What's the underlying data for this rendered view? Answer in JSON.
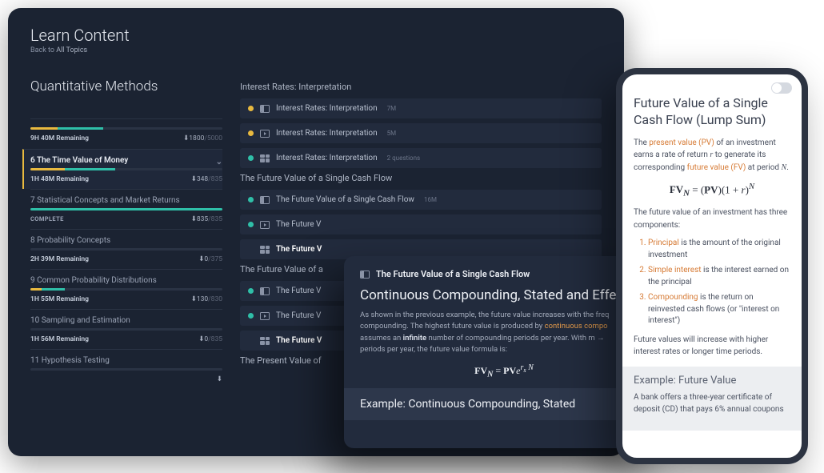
{
  "header": {
    "title": "Learn Content",
    "back_prefix": "Back to ",
    "back_link": "All Topics"
  },
  "sidebar": {
    "section_title": "Quantitative Methods",
    "overview": {
      "remaining": "9H 40M Remaining",
      "points": "1800",
      "max": "/5000",
      "yellow_pct": 14,
      "teal_pct": 24
    },
    "chapters": [
      {
        "title": "6 The Time Value of Money",
        "remaining": "1H 48M Remaining",
        "points": "348",
        "max": "/835",
        "active": true,
        "yellow_pct": 18,
        "teal_pct": 26
      },
      {
        "title": "7 Statistical Concepts and Market Returns",
        "status": "COMPLETE",
        "points": "835",
        "max": "/835",
        "yellow_pct": 0,
        "teal_pct": 100
      },
      {
        "title": "8 Probability Concepts",
        "remaining": "2H 39M Remaining",
        "points": "0",
        "max": "/375",
        "yellow_pct": 0,
        "teal_pct": 0
      },
      {
        "title": "9 Common Probability Distributions",
        "remaining": "1H 55M Remaining",
        "points": "130",
        "max": "/830",
        "yellow_pct": 6,
        "teal_pct": 12
      },
      {
        "title": "10 Sampling and Estimation",
        "remaining": "1H 56M Remaining",
        "points": "0",
        "max": "/835",
        "yellow_pct": 0,
        "teal_pct": 0
      },
      {
        "title": "11 Hypothesis Testing",
        "remaining": "",
        "points": "",
        "max": "",
        "yellow_pct": 0,
        "teal_pct": 0
      }
    ]
  },
  "content": {
    "groups": [
      {
        "title": "Interest Rates: Interpretation",
        "lessons": [
          {
            "dot": "y",
            "type": "read",
            "title": "Interest Rates: Interpretation",
            "meta": "7M"
          },
          {
            "dot": "y",
            "type": "video",
            "title": "Interest Rates: Interpretation",
            "meta": "5M"
          },
          {
            "dot": "t",
            "type": "quiz",
            "title": "Interest Rates: Interpretation",
            "meta": "2 questions"
          }
        ]
      },
      {
        "title": "The Future Value of a Single Cash Flow",
        "lessons": [
          {
            "dot": "t",
            "type": "read",
            "title": "The Future Value of a Single Cash Flow",
            "meta": "16M"
          },
          {
            "dot": "t",
            "type": "video",
            "title": "The Future V",
            "meta": ""
          },
          {
            "dot": "",
            "type": "quiz",
            "title": "The Future V",
            "meta": "",
            "hl": true
          }
        ]
      },
      {
        "title": "The Future Value of a",
        "lessons": [
          {
            "dot": "t",
            "type": "read",
            "title": "The Future V",
            "meta": ""
          },
          {
            "dot": "t",
            "type": "video",
            "title": "The Future V",
            "meta": ""
          },
          {
            "dot": "",
            "type": "quiz",
            "title": "The Future V",
            "meta": "",
            "hl": true
          }
        ]
      },
      {
        "title": "The Present Value of",
        "lessons": []
      }
    ]
  },
  "overlay": {
    "crumb": "The Future Value of a Single Cash Flow",
    "heading": "Continuous Compounding, Stated and Effe",
    "para_pre": "As shown in the previous example, the future value increases with the freq",
    "para_mid1": "compounding. The highest future value is produced by ",
    "para_accent": "continuous compo",
    "para_mid2": "assumes an ",
    "para_bold": "infinite",
    "para_mid3": " number of compounding periods per year. With ",
    "para_var": "m →",
    "para_tail": "periods per year, the future value formula is:",
    "formula": "FV_N = PVe^{r_s N}",
    "footer": "Example: Continuous Compounding, Stated"
  },
  "phone": {
    "title": "Future Value of a Single Cash Flow (Lump Sum)",
    "intro_pre": "The ",
    "intro_pv": "present value (PV)",
    "intro_mid1": " of an investment earns a rate of return ",
    "intro_r": "r",
    "intro_mid2": " to generate its corresponding ",
    "intro_fv": "future value (FV)",
    "intro_post": " at period ",
    "intro_N": "N",
    "formula": "FV_N = (PV)(1 + r)^N",
    "components_lead": "The future value of an investment has three components:",
    "items": [
      {
        "term": "Principal",
        "desc": " is the amount of the original investment"
      },
      {
        "term": "Simple interest",
        "desc": " is the interest earned on the principal"
      },
      {
        "term": "Compounding",
        "desc": " is the return on reinvested cash flows (or \"interest on interest\")"
      }
    ],
    "closing": "Future values will increase with higher interest rates or longer time periods.",
    "example_head": "Example: Future Value",
    "example_body": "A bank offers a three-year certificate of deposit (CD) that pays 6% annual coupons"
  }
}
